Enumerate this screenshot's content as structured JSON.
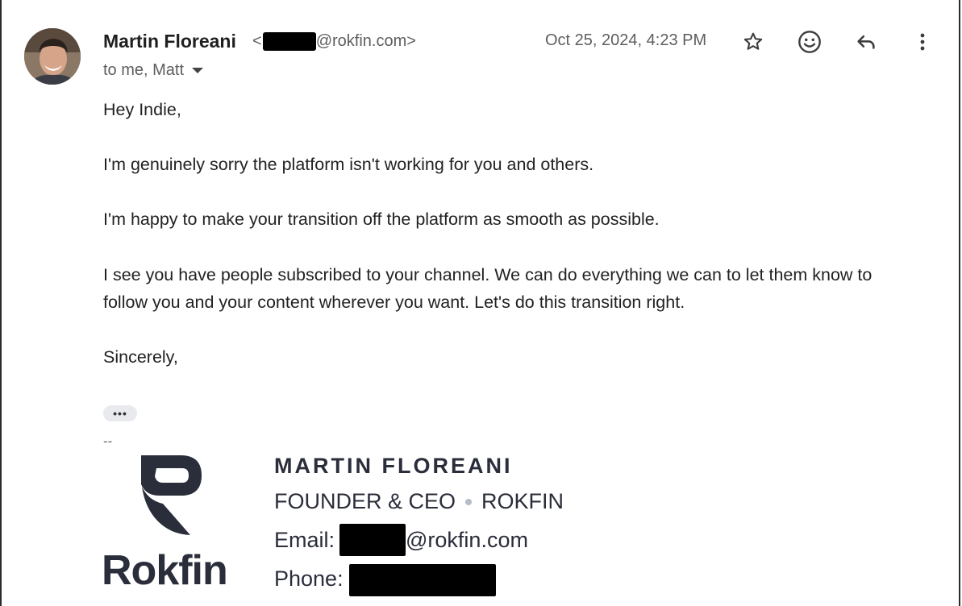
{
  "header": {
    "sender_name": "Martin Floreani",
    "sender_email_prefix": "<",
    "sender_email_domain": "@rokfin.com>",
    "date": "Oct 25, 2024, 4:23 PM",
    "recipients": "to me, Matt",
    "actions": [
      "star-icon",
      "emoji-icon",
      "reply-icon",
      "more-vert-icon"
    ]
  },
  "body": {
    "greeting": "Hey Indie,",
    "p1": "I'm genuinely sorry the platform isn't working for you and others.",
    "p2": "I'm happy to make your transition off the platform as smooth as possible.",
    "p3_line1": "I see you have people subscribed to your channel. We can do everything we can to let them know to",
    "p3_line2": "follow you and your content wherever you want. Let's do this transition right.",
    "signoff": "Sincerely,"
  },
  "trimmed_button": "•••",
  "signature": {
    "separator": "--",
    "logo_word": "Rokfin",
    "name": "MARTIN FLOREANI",
    "title": "FOUNDER & CEO",
    "company": "ROKFIN",
    "email_label": "Email:",
    "email_domain": "@rokfin.com",
    "phone_label": "Phone:"
  },
  "colors": {
    "text_primary": "#1f1f1f",
    "text_secondary": "#5e5e5e",
    "signature_navy": "#2a2d3a",
    "redaction": "#000000"
  }
}
